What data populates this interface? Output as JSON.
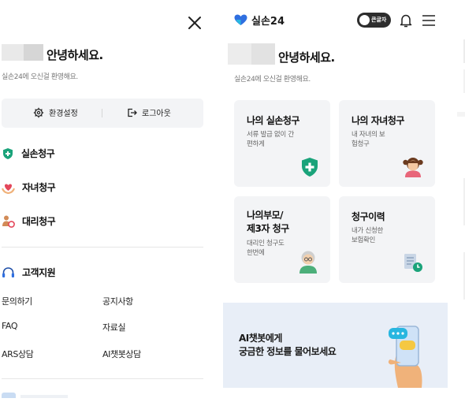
{
  "menu_panel": {
    "greeting": "안녕하세요.",
    "welcome": "실손24에 오신걸 환영해요.",
    "settings_label": "환경설정",
    "logout_label": "로그아웃",
    "items": [
      {
        "label": "실손청구",
        "icon": "cross-shield-icon"
      },
      {
        "label": "자녀청구",
        "icon": "heart-hands-icon"
      },
      {
        "label": "대리청구",
        "icon": "person-badge-icon"
      }
    ],
    "support_title": "고객지원",
    "support_links": [
      "문의하기",
      "공지사항",
      "FAQ",
      "자료실",
      "ARS상담",
      "AI챗봇상담"
    ]
  },
  "home_panel": {
    "brand": "실손24",
    "toggle_label": "큰글자",
    "greeting": "안녕하세요.",
    "welcome": "실손24에 오신걸 환영해요.",
    "cards": [
      {
        "title": "나의 실손청구",
        "desc": "서류 발급 없이 간편하게"
      },
      {
        "title": "나의 자녀청구",
        "desc": "내 자녀의 보험청구"
      },
      {
        "title": "나의부모/ 제3자 청구",
        "desc": "대리인 청구도 한번에"
      },
      {
        "title": "청구이력",
        "desc": "내가 신청한 보험확인"
      }
    ],
    "banner_line1": "AI챗봇에게",
    "banner_line2": "궁금한 정보를 물어보세요"
  },
  "colors": {
    "accent": "#1aa37a",
    "brand_blue": "#2f6fe0",
    "card_bg": "#f3f4f6",
    "banner_bg": "#e8eef7"
  }
}
